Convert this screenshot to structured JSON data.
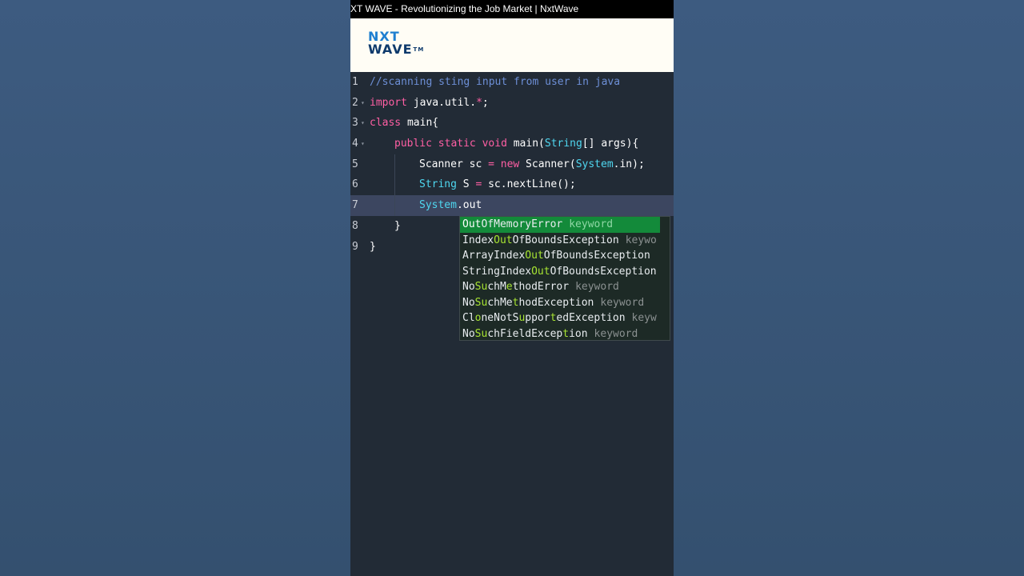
{
  "window": {
    "title": "XT WAVE - Revolutionizing the Job Market | NxtWave"
  },
  "logo": {
    "line1": "NXT",
    "line2": "WAVE",
    "tm": "TM"
  },
  "editor": {
    "lines": [
      {
        "num": "1"
      },
      {
        "num": "2"
      },
      {
        "num": "3"
      },
      {
        "num": "4"
      },
      {
        "num": "5"
      },
      {
        "num": "6"
      },
      {
        "num": "7"
      },
      {
        "num": "8"
      },
      {
        "num": "9"
      }
    ],
    "tokens": {
      "l1_comment": "//scanning sting input from user in java",
      "l2_import": "import",
      "l2_rest": " java.util.",
      "l2_star": "*",
      "l2_semi": ";",
      "l3_class": "class",
      "l3_rest": " main{",
      "l4_public": "public",
      "l4_static": "static",
      "l4_void": "void",
      "l4_main": " main(",
      "l4_String": "String",
      "l4_rest": "[] args){",
      "l5_a": "Scanner sc ",
      "l5_eq": "=",
      "l5_new": "new",
      "l5_b": " Scanner(",
      "l5_System": "System",
      "l5_c": ".in);",
      "l6_String": "String",
      "l6_a": " S ",
      "l6_eq": "=",
      "l6_b": " sc.nextLine();",
      "l7_System": "System",
      "l7_a": ".out",
      "l8_brace": "}",
      "l9_brace": "}"
    }
  },
  "autocomplete": {
    "items": [
      {
        "parts": [
          [
            "m",
            "Out"
          ],
          [
            "t",
            "OfMemoryError"
          ]
        ],
        "meta": "keyword"
      },
      {
        "parts": [
          [
            "t",
            "Index"
          ],
          [
            "m",
            "Out"
          ],
          [
            "t",
            "OfBoundsException"
          ]
        ],
        "meta": "keywo"
      },
      {
        "parts": [
          [
            "t",
            "ArrayIndex"
          ],
          [
            "m",
            "Out"
          ],
          [
            "t",
            "OfBoundsException"
          ]
        ],
        "meta": ""
      },
      {
        "parts": [
          [
            "t",
            "StringIndex"
          ],
          [
            "m",
            "Out"
          ],
          [
            "t",
            "OfBoundsException"
          ]
        ],
        "meta": ""
      },
      {
        "parts": [
          [
            "t",
            "No"
          ],
          [
            "m",
            "Su"
          ],
          [
            "t",
            "chM"
          ],
          [
            "m",
            "e"
          ],
          [
            "t",
            "thodError"
          ]
        ],
        "meta": "keyword"
      },
      {
        "parts": [
          [
            "t",
            "No"
          ],
          [
            "m",
            "Su"
          ],
          [
            "t",
            "chMe"
          ],
          [
            "m",
            "t"
          ],
          [
            "t",
            "hodException"
          ]
        ],
        "meta": "keyword"
      },
      {
        "parts": [
          [
            "t",
            "Cl"
          ],
          [
            "m",
            "o"
          ],
          [
            "t",
            "neNotS"
          ],
          [
            "m",
            "u"
          ],
          [
            "t",
            "ppor"
          ],
          [
            "m",
            "t"
          ],
          [
            "t",
            "edException"
          ]
        ],
        "meta": "keyw"
      },
      {
        "parts": [
          [
            "t",
            "No"
          ],
          [
            "m",
            "Su"
          ],
          [
            "t",
            "chFieldExcep"
          ],
          [
            "m",
            "t"
          ],
          [
            "t",
            "ion"
          ]
        ],
        "meta": "keyword"
      }
    ]
  }
}
